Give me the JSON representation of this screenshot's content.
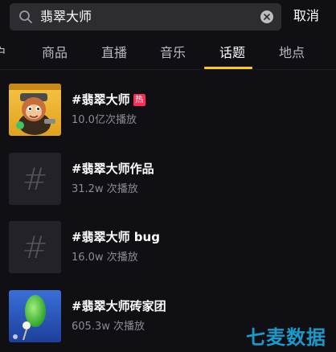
{
  "search": {
    "query": "翡翠大师",
    "cancel_label": "取消"
  },
  "tabs": [
    {
      "label": "户"
    },
    {
      "label": "商品"
    },
    {
      "label": "直播"
    },
    {
      "label": "音乐"
    },
    {
      "label": "话题",
      "active": true
    },
    {
      "label": "地点"
    }
  ],
  "results": [
    {
      "title": "#翡翠大师",
      "badge": "热",
      "plays": "10.0亿次播放",
      "thumb": "cartoon-monkey-image"
    },
    {
      "title": "#翡翠大师作品",
      "plays": "31.2w 次播放",
      "thumb_glyph": "#"
    },
    {
      "title": "#翡翠大师 bug",
      "plays": "16.0w 次播放",
      "thumb_glyph": "#"
    },
    {
      "title": "#翡翠大师砖家团",
      "plays": "605.3w 次播放",
      "thumb": "jade-pendant-image"
    }
  ],
  "watermark": "七麦数据",
  "colors": {
    "background": "#0f0f14",
    "search_bg": "#2c2c31",
    "tab_indicator": "#face15",
    "hot_badge": "#fe2c55",
    "watermark": "#1a9ac9"
  }
}
